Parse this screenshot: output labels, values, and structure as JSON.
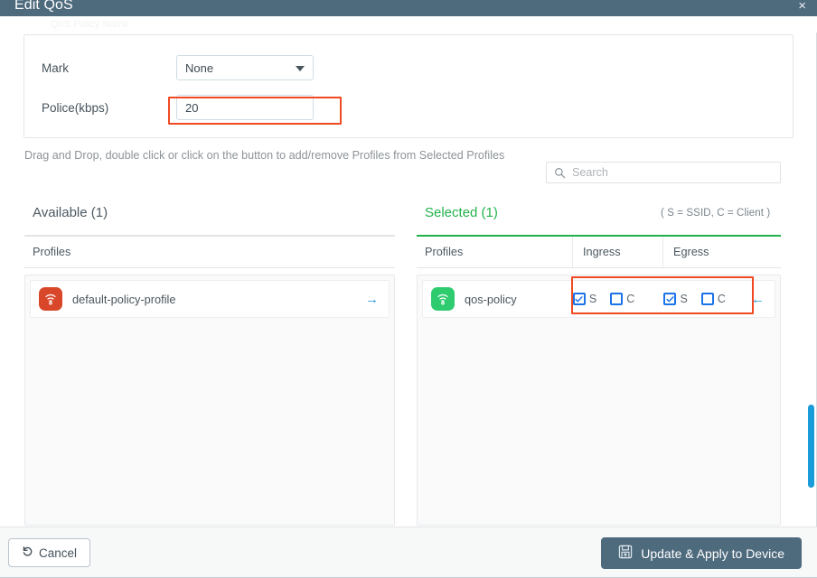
{
  "dialog": {
    "title": "Edit QoS",
    "close_label": "×",
    "ghost_text": "QoS Policy Name"
  },
  "form": {
    "mark": {
      "label": "Mark",
      "value": "None",
      "options": [
        "None"
      ]
    },
    "police": {
      "label": "Police(kbps)",
      "value": "20",
      "placeholder": ""
    }
  },
  "instructions": {
    "text": "Drag and Drop, double click or click on the button to add/remove Profiles from Selected Profiles"
  },
  "search": {
    "placeholder": "Search",
    "value": "",
    "icon": "search-icon"
  },
  "panes": {
    "available": {
      "title": "Available (1)",
      "columns": [
        "Profiles"
      ],
      "rows": [
        {
          "name": "default-policy-profile",
          "icon": "wifi-profile-icon",
          "icon_color": "#d9472b",
          "arrow": "→",
          "arrow_name": "move-right-arrow-icon"
        }
      ]
    },
    "selected": {
      "title": "Selected (1)",
      "title_color": "#22b24c",
      "legend": "( S = SSID, C = Client )",
      "columns": [
        "Profiles",
        "Ingress",
        "Egress"
      ],
      "rows": [
        {
          "name": "qos-policy",
          "icon": "wifi-profile-icon",
          "icon_color": "#2fcc6f",
          "arrow": "←",
          "arrow_name": "move-left-arrow-icon",
          "ingress": {
            "ssid_label": "S",
            "ssid_checked": true,
            "client_label": "C",
            "client_checked": false
          },
          "egress": {
            "ssid_label": "S",
            "ssid_checked": true,
            "client_label": "C",
            "client_checked": false
          }
        }
      ]
    }
  },
  "footer": {
    "cancel_label": "Cancel",
    "cancel_icon": "undo-icon",
    "apply_label": "Update & Apply to Device",
    "apply_icon": "save-icon"
  },
  "colors": {
    "titlebar": "#4e6a7d",
    "accent_green": "#22b24c",
    "accent_blue": "#1a73e8",
    "annotation_orange": "#f04a23",
    "scrollbar_blue": "#1a9cd8"
  }
}
